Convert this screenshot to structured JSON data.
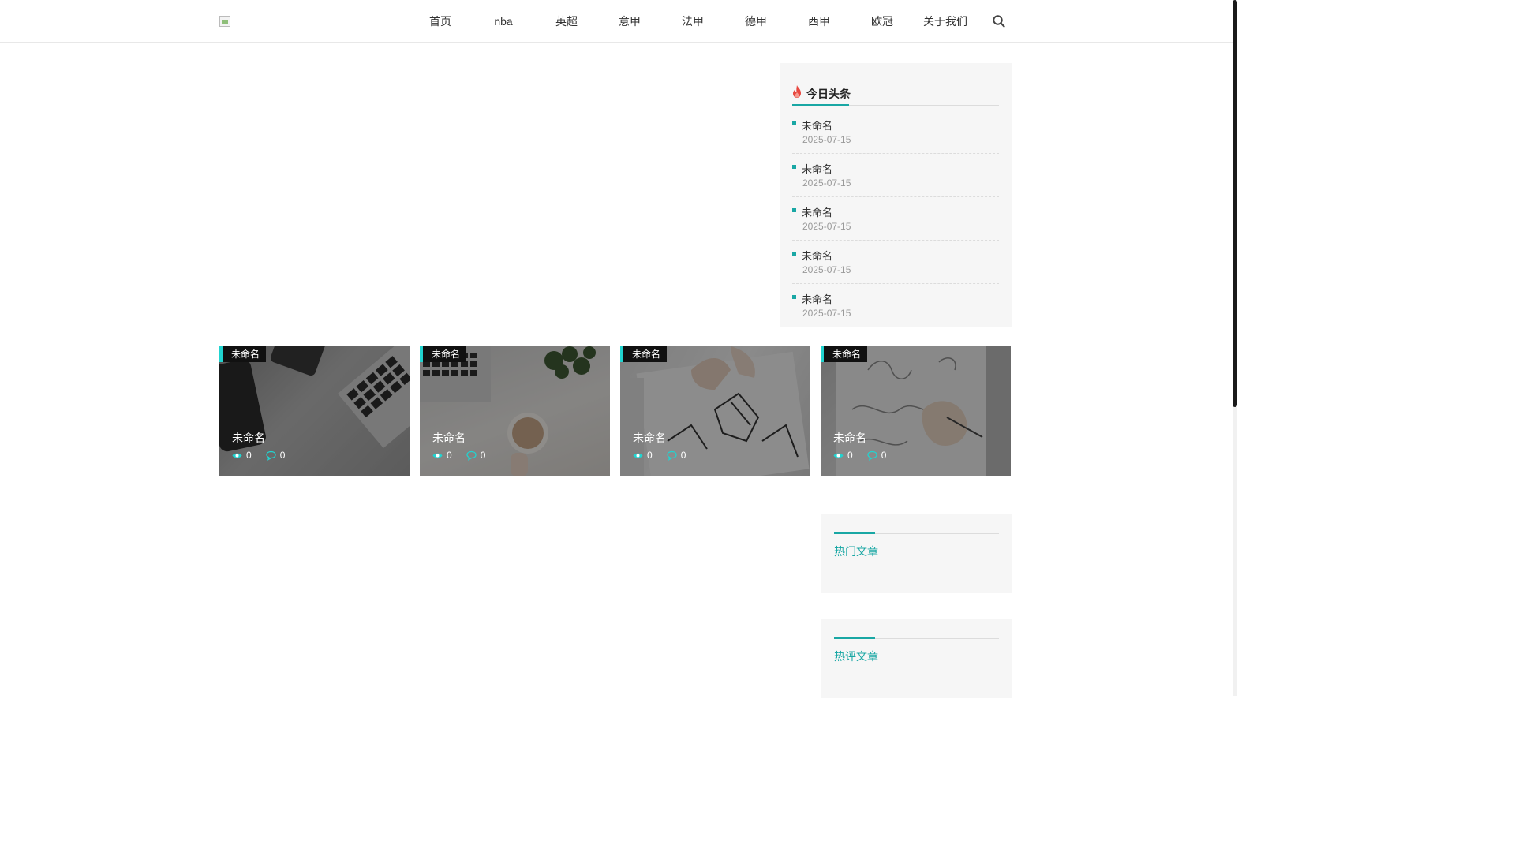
{
  "nav": {
    "items": [
      {
        "label": "首页"
      },
      {
        "label": "nba"
      },
      {
        "label": "英超"
      },
      {
        "label": "意甲"
      },
      {
        "label": "法甲"
      },
      {
        "label": "德甲"
      },
      {
        "label": "西甲"
      },
      {
        "label": "欧冠"
      },
      {
        "label": "关于我们"
      }
    ],
    "search_icon": "search-icon"
  },
  "headlines": {
    "title": "今日头条",
    "icon": "fire-icon",
    "items": [
      {
        "title": "未命名",
        "date": "2025-07-15"
      },
      {
        "title": "未命名",
        "date": "2025-07-15"
      },
      {
        "title": "未命名",
        "date": "2025-07-15"
      },
      {
        "title": "未命名",
        "date": "2025-07-15"
      },
      {
        "title": "未命名",
        "date": "2025-07-15"
      }
    ]
  },
  "cards": [
    {
      "tag": "未命名",
      "title": "未命名",
      "views": "0",
      "comments": "0"
    },
    {
      "tag": "未命名",
      "title": "未命名",
      "views": "0",
      "comments": "0"
    },
    {
      "tag": "未命名",
      "title": "未命名",
      "views": "0",
      "comments": "0"
    },
    {
      "tag": "未命名",
      "title": "未命名",
      "views": "0",
      "comments": "0"
    }
  ],
  "sidebar": {
    "hot_articles": "热门文章",
    "hot_comments": "热评文章"
  },
  "colors": {
    "accent": "#19a7a4",
    "tag_border": "#21d4d0",
    "card_icon": "#21d4d0"
  }
}
